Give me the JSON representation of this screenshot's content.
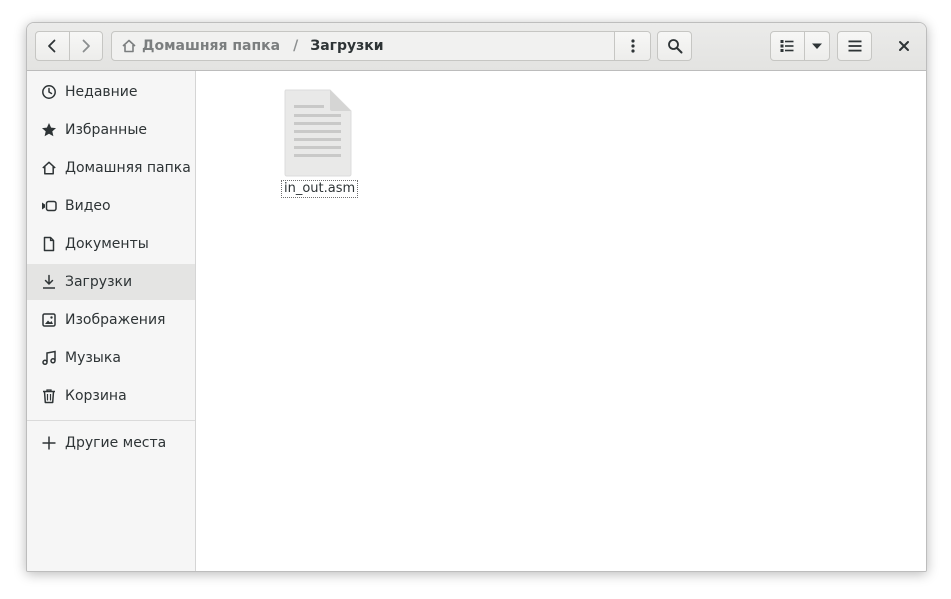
{
  "header": {
    "back_icon": "chevron-left-icon",
    "forward_icon": "chevron-right-icon",
    "path": {
      "home_label": "Домашняя папка",
      "separator": "/",
      "current": "Загрузки"
    },
    "path_menu_icon": "vertical-dots-icon",
    "search_icon": "search-icon",
    "view_list_icon": "list-view-icon",
    "view_options_icon": "triangle-down-icon",
    "main_menu_icon": "hamburger-menu-icon",
    "close_icon": "close-icon"
  },
  "sidebar": {
    "items": [
      {
        "label": "Недавние",
        "icon": "clock-icon"
      },
      {
        "label": "Избранные",
        "icon": "star-icon"
      },
      {
        "label": "Домашняя папка",
        "icon": "home-icon"
      },
      {
        "label": "Видео",
        "icon": "video-icon"
      },
      {
        "label": "Документы",
        "icon": "document-icon"
      },
      {
        "label": "Загрузки",
        "icon": "download-icon",
        "active": true
      },
      {
        "label": "Изображения",
        "icon": "image-icon"
      },
      {
        "label": "Музыка",
        "icon": "music-icon"
      },
      {
        "label": "Корзина",
        "icon": "trash-icon"
      }
    ],
    "other": {
      "label": "Другие места",
      "icon": "plus-icon"
    }
  },
  "content": {
    "files": [
      {
        "name": "in_out.asm",
        "icon": "text-file-icon"
      }
    ]
  },
  "colors": {
    "headerbar": "#e8e8e7",
    "sidebar": "#f6f6f6",
    "sidebar_active": "#e4e4e3",
    "text": "#2e3436"
  }
}
